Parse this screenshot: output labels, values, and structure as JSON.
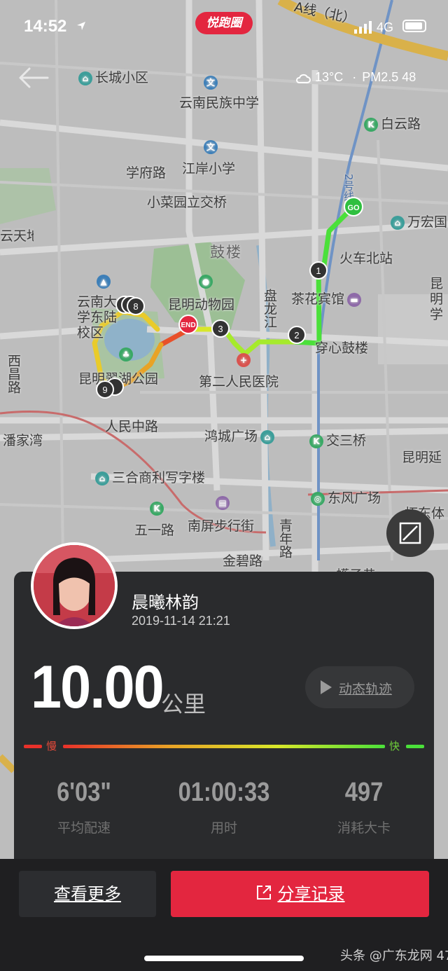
{
  "status_bar": {
    "time": "14:52",
    "network": "4G"
  },
  "brand": {
    "label": "悦跑圈",
    "color": "#e3263f"
  },
  "weather": {
    "temperature": "13°C",
    "separator": "·",
    "air_quality": "PM2.5 48"
  },
  "map": {
    "place_labels": [
      {
        "text": "长城小区",
        "icon": "building-icon"
      },
      {
        "text": "云南民族中学",
        "icon": "school-icon"
      },
      {
        "text": "白云路",
        "icon": "transit-icon"
      },
      {
        "text": "学府路"
      },
      {
        "text": "江岸小学",
        "icon": "school-icon"
      },
      {
        "text": "小菜园立交桥"
      },
      {
        "text": "万宏国",
        "icon": "building-icon"
      },
      {
        "text": "鼓楼"
      },
      {
        "text": "火车北站"
      },
      {
        "text": "昆明动物园",
        "icon": "panda-icon"
      },
      {
        "text": "茶花宾馆",
        "icon": "hotel-icon"
      },
      {
        "text": "云南大学东陆校区",
        "icon": "university-icon"
      },
      {
        "text": "盘龙江"
      },
      {
        "text": "穿心鼓楼",
        "icon": "transit-icon"
      },
      {
        "text": "第二人民医院",
        "icon": "hospital-icon"
      },
      {
        "text": "昆明翠湖公园",
        "icon": "park-icon"
      },
      {
        "text": "西昌路"
      },
      {
        "text": "人民中路"
      },
      {
        "text": "潘家湾",
        "icon": "transit-icon"
      },
      {
        "text": "鸿城广场",
        "icon": "building-icon"
      },
      {
        "text": "交三桥",
        "icon": "transit-icon"
      },
      {
        "text": "昆明延",
        "icon": "hospital-icon"
      },
      {
        "text": "三合商利写字楼",
        "icon": "building-icon"
      },
      {
        "text": "东风广场",
        "icon": "transit-icon"
      },
      {
        "text": "五一路",
        "icon": "transit-icon"
      },
      {
        "text": "南屏步行街",
        "icon": "shopping-icon"
      },
      {
        "text": "青年路"
      },
      {
        "text": "拓东体",
        "icon": "transit-icon"
      },
      {
        "text": "金碧路"
      },
      {
        "text": "蠖子巷"
      },
      {
        "text": "云天地"
      },
      {
        "text": "昆明学"
      },
      {
        "text": "A线（北）"
      },
      {
        "text": "2号线"
      }
    ],
    "route_markers": {
      "start": "GO",
      "end": "END",
      "kilometers": [
        "1",
        "2",
        "3",
        "8",
        "9"
      ]
    }
  },
  "profile": {
    "username": "晨曦林韵",
    "datetime": "2019-11-14 21:21"
  },
  "run": {
    "distance": "10.00",
    "distance_unit": "公里",
    "replay_label": "动态轨迹",
    "pace_slow_label": "慢",
    "pace_fast_label": "快",
    "stats": [
      {
        "value": "6'03\"",
        "label": "平均配速"
      },
      {
        "value": "01:00:33",
        "label": "用时"
      },
      {
        "value": "497",
        "label": "消耗大卡"
      }
    ]
  },
  "actions": {
    "more_label": "查看更多",
    "share_label": "分享记录"
  },
  "watermark": "头条 @广东龙网 47"
}
